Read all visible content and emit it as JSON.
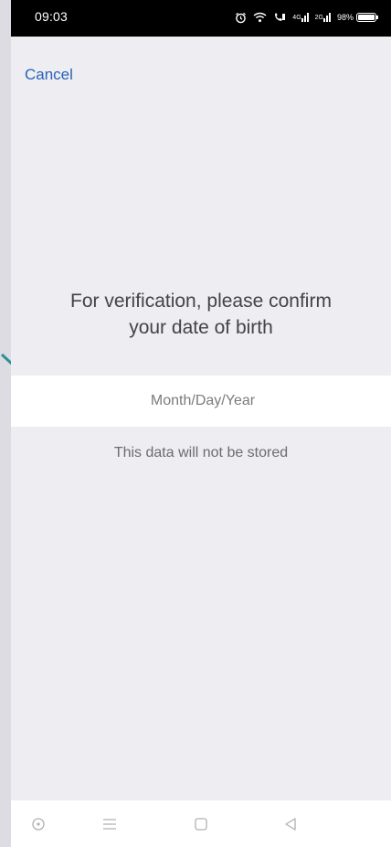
{
  "status_bar": {
    "time": "09:03",
    "signal_label_1": "4G",
    "signal_label_2": "2G",
    "battery_text": "98%",
    "battery_level": 0.98
  },
  "header": {
    "cancel_label": "Cancel"
  },
  "main": {
    "heading_line1": "For verification, please confirm",
    "heading_line2": "your date of birth",
    "dob_field": {
      "value": "",
      "placeholder": "Month/Day/Year"
    },
    "note": "This data will not be stored"
  },
  "nav_bar": {
    "icons": [
      "radio-dot-icon",
      "menu-icon",
      "home-square-icon",
      "back-triangle-icon"
    ]
  },
  "colors": {
    "accent": "#2a63b8",
    "background": "#ededf2",
    "decor_arrow": "#2f8f98"
  }
}
